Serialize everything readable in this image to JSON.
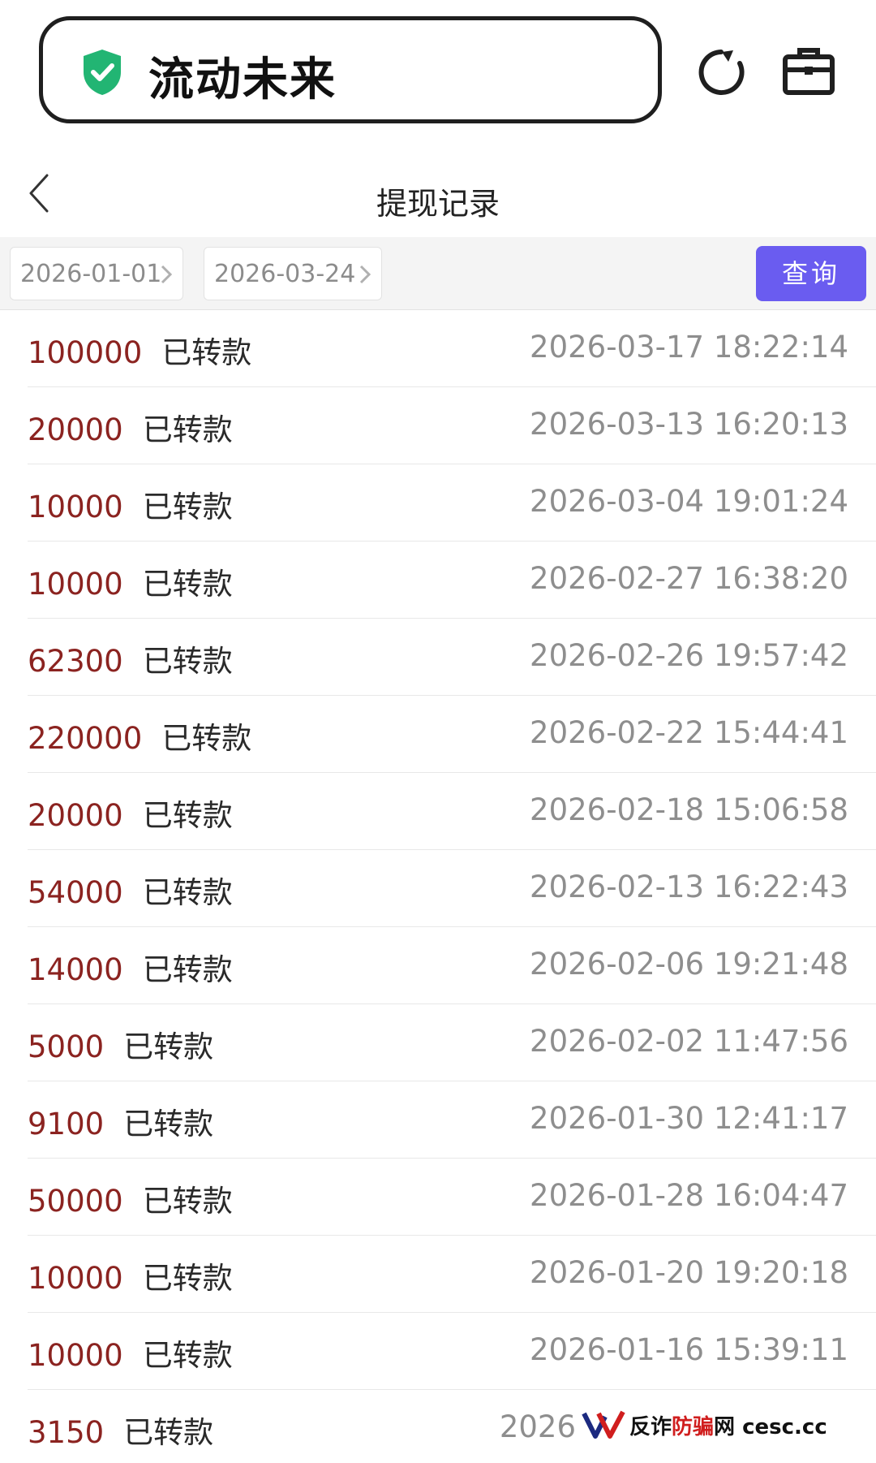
{
  "app": {
    "name": "流动未来"
  },
  "nav": {
    "title": "提现记录"
  },
  "filter": {
    "start_date": "2026-01-01",
    "end_date": "2026-03-24",
    "query_label": "查询"
  },
  "records": [
    {
      "amount": "100000",
      "status": "已转款",
      "time": "2026-03-17 18:22:14"
    },
    {
      "amount": "20000",
      "status": "已转款",
      "time": "2026-03-13 16:20:13"
    },
    {
      "amount": "10000",
      "status": "已转款",
      "time": "2026-03-04 19:01:24"
    },
    {
      "amount": "10000",
      "status": "已转款",
      "time": "2026-02-27 16:38:20"
    },
    {
      "amount": "62300",
      "status": "已转款",
      "time": "2026-02-26 19:57:42"
    },
    {
      "amount": "220000",
      "status": "已转款",
      "time": "2026-02-22 15:44:41"
    },
    {
      "amount": "20000",
      "status": "已转款",
      "time": "2026-02-18 15:06:58"
    },
    {
      "amount": "54000",
      "status": "已转款",
      "time": "2026-02-13 16:22:43"
    },
    {
      "amount": "14000",
      "status": "已转款",
      "time": "2026-02-06 19:21:48"
    },
    {
      "amount": "5000",
      "status": "已转款",
      "time": "2026-02-02 11:47:56"
    },
    {
      "amount": "9100",
      "status": "已转款",
      "time": "2026-01-30 12:41:17"
    },
    {
      "amount": "50000",
      "status": "已转款",
      "time": "2026-01-28 16:04:47"
    },
    {
      "amount": "10000",
      "status": "已转款",
      "time": "2026-01-20 19:20:18"
    },
    {
      "amount": "10000",
      "status": "已转款",
      "time": "2026-01-16 15:39:11"
    },
    {
      "amount": "3150",
      "status": "已转款",
      "time": "2026"
    }
  ],
  "watermark": {
    "text_part1": "反诈",
    "text_part2": "防骗",
    "text_part3": "网",
    "site": "cesc.cc"
  },
  "colors": {
    "accent": "#6a5cf0",
    "amount": "#8b2320",
    "shield": "#22b573"
  }
}
